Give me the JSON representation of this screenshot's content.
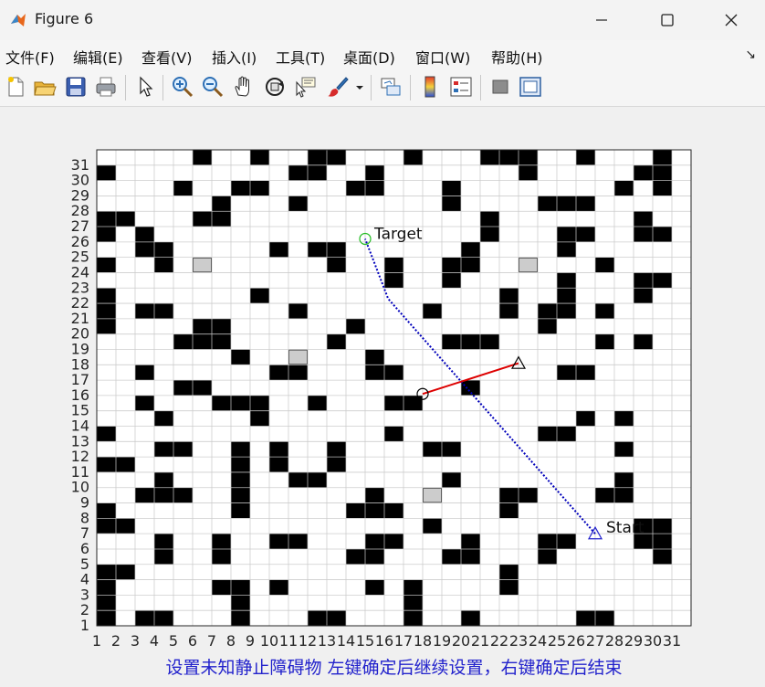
{
  "window": {
    "title": "Figure 6",
    "minimize_icon": "minimize-icon",
    "maximize_icon": "maximize-icon",
    "close_icon": "close-icon"
  },
  "menu": {
    "items": [
      {
        "label": "文件(F)"
      },
      {
        "label": "编辑(E)"
      },
      {
        "label": "查看(V)"
      },
      {
        "label": "插入(I)"
      },
      {
        "label": "工具(T)"
      },
      {
        "label": "桌面(D)"
      },
      {
        "label": "窗口(W)"
      },
      {
        "label": "帮助(H)"
      }
    ],
    "dock_arrow": "↘"
  },
  "toolbar": {
    "tools": [
      "new-figure-icon",
      "open-file-icon",
      "save-icon",
      "print-icon",
      "select-pointer-icon",
      "zoom-in-icon",
      "zoom-out-icon",
      "pan-hand-icon",
      "rotate-3d-icon",
      "data-cursor-icon",
      "brush-icon",
      "brush-dropdown-icon",
      "link-plot-icon",
      "insert-colorbar-icon",
      "insert-legend-icon",
      "hide-plot-tools-icon",
      "show-plot-tools-icon"
    ]
  },
  "plot": {
    "grid_size": 31,
    "x_ticks": [
      "1",
      "2",
      "3",
      "4",
      "5",
      "6",
      "7",
      "8",
      "9",
      "10",
      "11",
      "12",
      "13",
      "14",
      "15",
      "16",
      "17",
      "18",
      "19",
      "20",
      "21",
      "22",
      "23",
      "24",
      "25",
      "26",
      "27",
      "28",
      "29",
      "30",
      "31"
    ],
    "y_ticks": [
      "1",
      "2",
      "3",
      "4",
      "5",
      "6",
      "7",
      "8",
      "9",
      "10",
      "11",
      "12",
      "13",
      "14",
      "15",
      "16",
      "17",
      "18",
      "19",
      "20",
      "21",
      "22",
      "23",
      "24",
      "25",
      "26",
      "27",
      "28",
      "29",
      "30",
      "31"
    ],
    "xlabel": "设置未知静止障碍物 左键确定后继续设置，右键确定后结束",
    "xlabel_color": "#2222cc",
    "obstacle_color": "#000000",
    "unknown_obstacle_color": "#cccccc",
    "obstacles": [
      [
        6,
        31
      ],
      [
        9,
        31
      ],
      [
        12,
        31
      ],
      [
        13,
        31
      ],
      [
        17,
        31
      ],
      [
        21,
        31
      ],
      [
        22,
        31
      ],
      [
        23,
        31
      ],
      [
        26,
        31
      ],
      [
        30,
        31
      ],
      [
        1,
        30
      ],
      [
        11,
        30
      ],
      [
        12,
        30
      ],
      [
        15,
        30
      ],
      [
        23,
        30
      ],
      [
        29,
        30
      ],
      [
        30,
        30
      ],
      [
        5,
        29
      ],
      [
        8,
        29
      ],
      [
        9,
        29
      ],
      [
        14,
        29
      ],
      [
        15,
        29
      ],
      [
        19,
        29
      ],
      [
        28,
        29
      ],
      [
        30,
        29
      ],
      [
        7,
        28
      ],
      [
        11,
        28
      ],
      [
        19,
        28
      ],
      [
        24,
        28
      ],
      [
        25,
        28
      ],
      [
        26,
        28
      ],
      [
        1,
        27
      ],
      [
        2,
        27
      ],
      [
        6,
        27
      ],
      [
        7,
        27
      ],
      [
        21,
        27
      ],
      [
        29,
        27
      ],
      [
        1,
        26
      ],
      [
        3,
        26
      ],
      [
        21,
        26
      ],
      [
        25,
        26
      ],
      [
        26,
        26
      ],
      [
        29,
        26
      ],
      [
        30,
        26
      ],
      [
        3,
        25
      ],
      [
        4,
        25
      ],
      [
        10,
        25
      ],
      [
        12,
        25
      ],
      [
        13,
        25
      ],
      [
        20,
        25
      ],
      [
        25,
        25
      ],
      [
        1,
        24
      ],
      [
        4,
        24
      ],
      [
        13,
        24
      ],
      [
        16,
        24
      ],
      [
        19,
        24
      ],
      [
        20,
        24
      ],
      [
        27,
        24
      ],
      [
        16,
        23
      ],
      [
        19,
        23
      ],
      [
        25,
        23
      ],
      [
        29,
        23
      ],
      [
        30,
        23
      ],
      [
        1,
        22
      ],
      [
        9,
        22
      ],
      [
        22,
        22
      ],
      [
        25,
        22
      ],
      [
        29,
        22
      ],
      [
        1,
        21
      ],
      [
        3,
        21
      ],
      [
        4,
        21
      ],
      [
        11,
        21
      ],
      [
        18,
        21
      ],
      [
        22,
        21
      ],
      [
        24,
        21
      ],
      [
        25,
        21
      ],
      [
        27,
        21
      ],
      [
        1,
        20
      ],
      [
        6,
        20
      ],
      [
        7,
        20
      ],
      [
        14,
        20
      ],
      [
        24,
        20
      ],
      [
        5,
        19
      ],
      [
        6,
        19
      ],
      [
        7,
        19
      ],
      [
        13,
        19
      ],
      [
        19,
        19
      ],
      [
        20,
        19
      ],
      [
        21,
        19
      ],
      [
        27,
        19
      ],
      [
        29,
        19
      ],
      [
        8,
        18
      ],
      [
        15,
        18
      ],
      [
        3,
        17
      ],
      [
        10,
        17
      ],
      [
        11,
        17
      ],
      [
        15,
        17
      ],
      [
        16,
        17
      ],
      [
        25,
        17
      ],
      [
        26,
        17
      ],
      [
        5,
        16
      ],
      [
        6,
        16
      ],
      [
        20,
        16
      ],
      [
        3,
        15
      ],
      [
        7,
        15
      ],
      [
        8,
        15
      ],
      [
        9,
        15
      ],
      [
        12,
        15
      ],
      [
        16,
        15
      ],
      [
        17,
        15
      ],
      [
        4,
        14
      ],
      [
        9,
        14
      ],
      [
        26,
        14
      ],
      [
        28,
        14
      ],
      [
        1,
        13
      ],
      [
        16,
        13
      ],
      [
        24,
        13
      ],
      [
        25,
        13
      ],
      [
        4,
        12
      ],
      [
        5,
        12
      ],
      [
        8,
        12
      ],
      [
        10,
        12
      ],
      [
        13,
        12
      ],
      [
        18,
        12
      ],
      [
        19,
        12
      ],
      [
        28,
        12
      ],
      [
        1,
        11
      ],
      [
        2,
        11
      ],
      [
        8,
        11
      ],
      [
        10,
        11
      ],
      [
        13,
        11
      ],
      [
        4,
        10
      ],
      [
        8,
        10
      ],
      [
        11,
        10
      ],
      [
        12,
        10
      ],
      [
        19,
        10
      ],
      [
        28,
        10
      ],
      [
        3,
        9
      ],
      [
        4,
        9
      ],
      [
        5,
        9
      ],
      [
        8,
        9
      ],
      [
        15,
        9
      ],
      [
        22,
        9
      ],
      [
        23,
        9
      ],
      [
        27,
        9
      ],
      [
        28,
        9
      ],
      [
        1,
        8
      ],
      [
        8,
        8
      ],
      [
        14,
        8
      ],
      [
        15,
        8
      ],
      [
        16,
        8
      ],
      [
        22,
        8
      ],
      [
        1,
        7
      ],
      [
        2,
        7
      ],
      [
        18,
        7
      ],
      [
        29,
        7
      ],
      [
        30,
        7
      ],
      [
        4,
        6
      ],
      [
        7,
        6
      ],
      [
        10,
        6
      ],
      [
        11,
        6
      ],
      [
        15,
        6
      ],
      [
        16,
        6
      ],
      [
        20,
        6
      ],
      [
        24,
        6
      ],
      [
        25,
        6
      ],
      [
        29,
        6
      ],
      [
        30,
        6
      ],
      [
        4,
        5
      ],
      [
        7,
        5
      ],
      [
        14,
        5
      ],
      [
        15,
        5
      ],
      [
        19,
        5
      ],
      [
        20,
        5
      ],
      [
        24,
        5
      ],
      [
        30,
        5
      ],
      [
        1,
        4
      ],
      [
        2,
        4
      ],
      [
        22,
        4
      ],
      [
        1,
        3
      ],
      [
        7,
        3
      ],
      [
        8,
        3
      ],
      [
        10,
        3
      ],
      [
        15,
        3
      ],
      [
        17,
        3
      ],
      [
        22,
        3
      ],
      [
        1,
        2
      ],
      [
        8,
        2
      ],
      [
        17,
        2
      ],
      [
        1,
        1
      ],
      [
        3,
        1
      ],
      [
        4,
        1
      ],
      [
        8,
        1
      ],
      [
        12,
        1
      ],
      [
        13,
        1
      ],
      [
        17,
        1
      ],
      [
        20,
        1
      ],
      [
        26,
        1
      ],
      [
        27,
        1
      ]
    ],
    "unknown_obstacles": [
      [
        6,
        24
      ],
      [
        23,
        24
      ],
      [
        11,
        18
      ],
      [
        18,
        9
      ]
    ],
    "start": {
      "x": 26.5,
      "y": 6.5,
      "label": "Start",
      "color": "#2222cc"
    },
    "target": {
      "x": 14.5,
      "y": 25.7,
      "label": "Target",
      "color": "#22bb22"
    },
    "planned_path": {
      "color": "#0000bb",
      "points": [
        [
          26.5,
          6.5
        ],
        [
          15.7,
          21.8
        ],
        [
          14.5,
          25.7
        ]
      ]
    },
    "robot": {
      "x": 17.5,
      "y": 15.6,
      "color": "#000000"
    },
    "waypoint": {
      "x": 22.5,
      "y": 17.6,
      "color": "#000000"
    },
    "heading_line": {
      "color": "#dd0000"
    }
  }
}
